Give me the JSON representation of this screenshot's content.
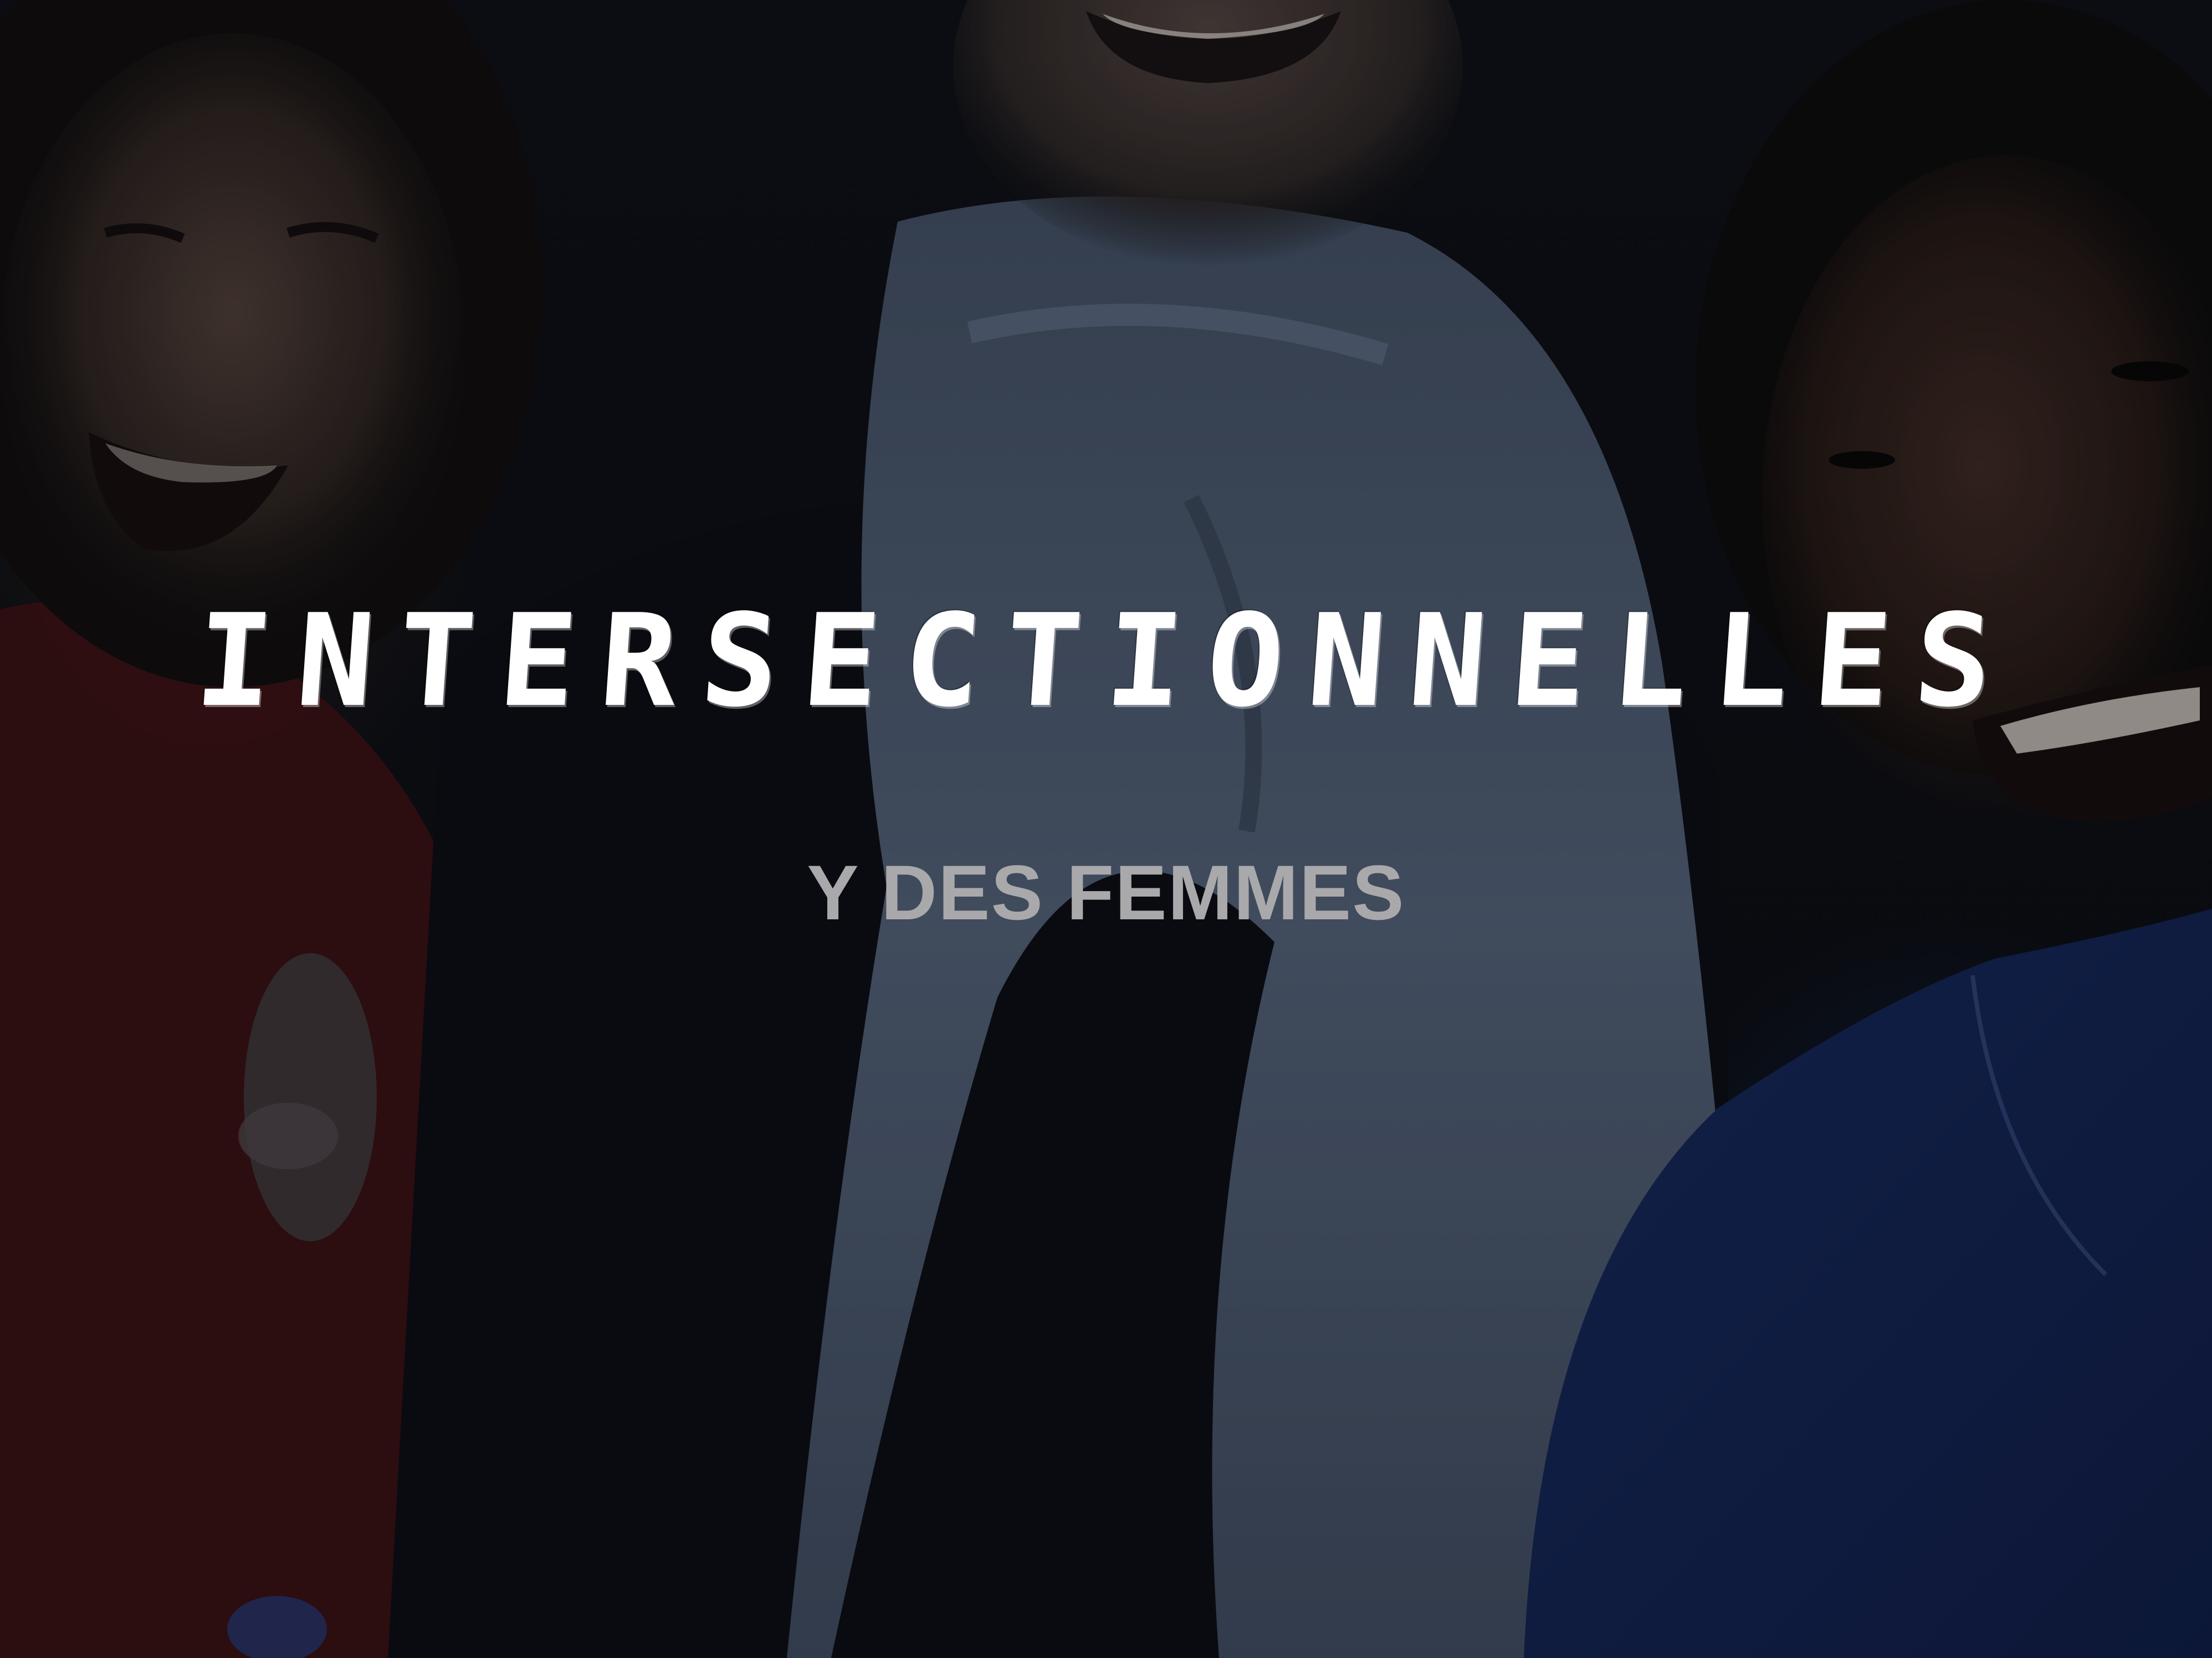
{
  "title": "INTERSECTIONNELLES",
  "subtitle": "Y DES FEMMES",
  "colors": {
    "title": "#ffffff",
    "subtitle": "#a9a9ab",
    "background": "#0a0b10",
    "scarf": "#5a6a80",
    "jacket_blue": "#1a2f6a",
    "sweater_red": "#5a1414"
  }
}
